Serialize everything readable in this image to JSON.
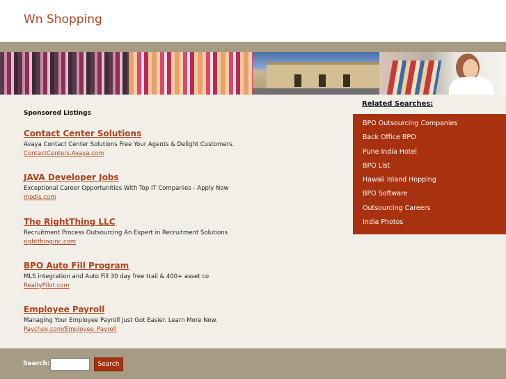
{
  "header": {
    "title": "Wn Shopping"
  },
  "sponsored": {
    "label": "Sponsored Listings",
    "listings": [
      {
        "title": "Contact Center Solutions",
        "description": "Avaya Contact Center Solutions Free Your Agents & Delight Customers.",
        "url": "ContactCenters.Avaya.com"
      },
      {
        "title": "JAVA Developer Jobs",
        "description": "Exceptional Career Opportunities With Top IT Companies - Apply Now",
        "url": "modis.com"
      },
      {
        "title": "The RightThing LLC",
        "description": "Recruitment Process Outsourcing An Expert in Recruitment Solutions",
        "url": "rightthinginc.com"
      },
      {
        "title": "BPO Auto Fill Program",
        "description": "MLS integration and Auto Fill 30 day free trail & 400+ asset co",
        "url": "RealtyPilot.com"
      },
      {
        "title": "Employee Payroll",
        "description": "Managing Your Employee Payroll Just Got Easier. Learn More Now.",
        "url": "Paychex.com/Employee_Payroll"
      }
    ]
  },
  "related": {
    "heading": "Related Searches:",
    "items": [
      "BPO Outsourcing Companies",
      "Back Office BPO",
      "Pune India Hotel",
      "BPO List",
      "Hawaii Island Hopping",
      "BPO Software",
      "Outsourcing Careers",
      "India Photos"
    ]
  },
  "footer": {
    "search_label": "Search:",
    "search_value": "",
    "search_button": "Search"
  },
  "colors": {
    "accent": "#b1421e",
    "related_bg": "#a8320f",
    "band": "#a69c83",
    "page_bg": "#f1efe8"
  }
}
